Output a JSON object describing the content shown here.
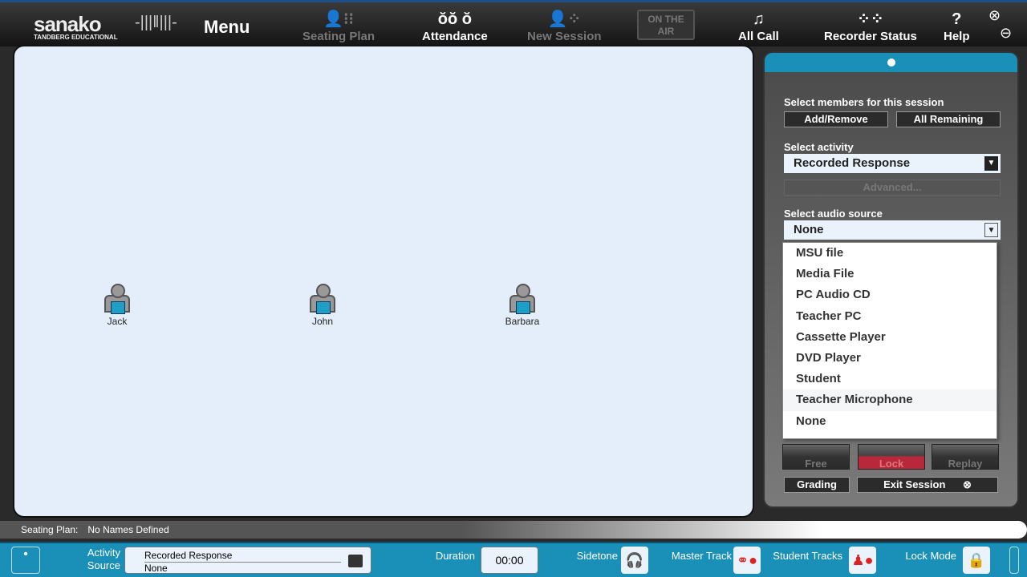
{
  "header": {
    "logo": "sanako",
    "logo_sub": "TANDBERG EDUCATIONAL",
    "menu": "Menu",
    "nav": [
      {
        "label": "Seating Plan",
        "icon": "seating-plan-icon",
        "enabled": false
      },
      {
        "label": "Attendance",
        "icon": "attendance-icon",
        "enabled": true
      },
      {
        "label": "New Session",
        "icon": "new-session-icon",
        "enabled": false
      },
      {
        "label": "All Call",
        "icon": "all-call-icon",
        "enabled": true
      },
      {
        "label": "Recorder Status",
        "icon": "recorder-status-icon",
        "enabled": true
      },
      {
        "label": "Help",
        "icon": "help-icon",
        "enabled": true
      }
    ],
    "on_air": "ON THE AIR"
  },
  "students": [
    {
      "name": "Jack"
    },
    {
      "name": "John"
    },
    {
      "name": "Barbara"
    }
  ],
  "panel": {
    "members_label": "Select members for this session",
    "add_remove": "Add/Remove",
    "all_remaining": "All Remaining",
    "activity_label": "Select activity",
    "activity_value": "Recorded Response",
    "advanced": "Advanced...",
    "audio_label": "Select audio source",
    "audio_value": "None",
    "audio_options": [
      "MSU file",
      "Media File",
      "PC Audio CD",
      "Teacher PC",
      "Cassette Player",
      "DVD Player",
      "Student",
      "Teacher Microphone",
      "None"
    ],
    "free": "Free",
    "lock": "Lock",
    "replay": "Replay",
    "grading": "Grading",
    "exit_session": "Exit Session"
  },
  "status": {
    "label": "Seating Plan:",
    "value": "No Names Defined"
  },
  "bottom": {
    "activity_label": "Activity",
    "source_label": "Source",
    "activity_value": "Recorded Response",
    "source_value": "None",
    "duration_label": "Duration",
    "duration": "00:00",
    "sidetone": "Sidetone",
    "master_track": "Master Track",
    "student_tracks": "Student Tracks",
    "lock_mode": "Lock Mode"
  },
  "colors": {
    "accent": "#1a8fb8",
    "canvas": "#e4eefb",
    "lock": "#b8283a"
  }
}
